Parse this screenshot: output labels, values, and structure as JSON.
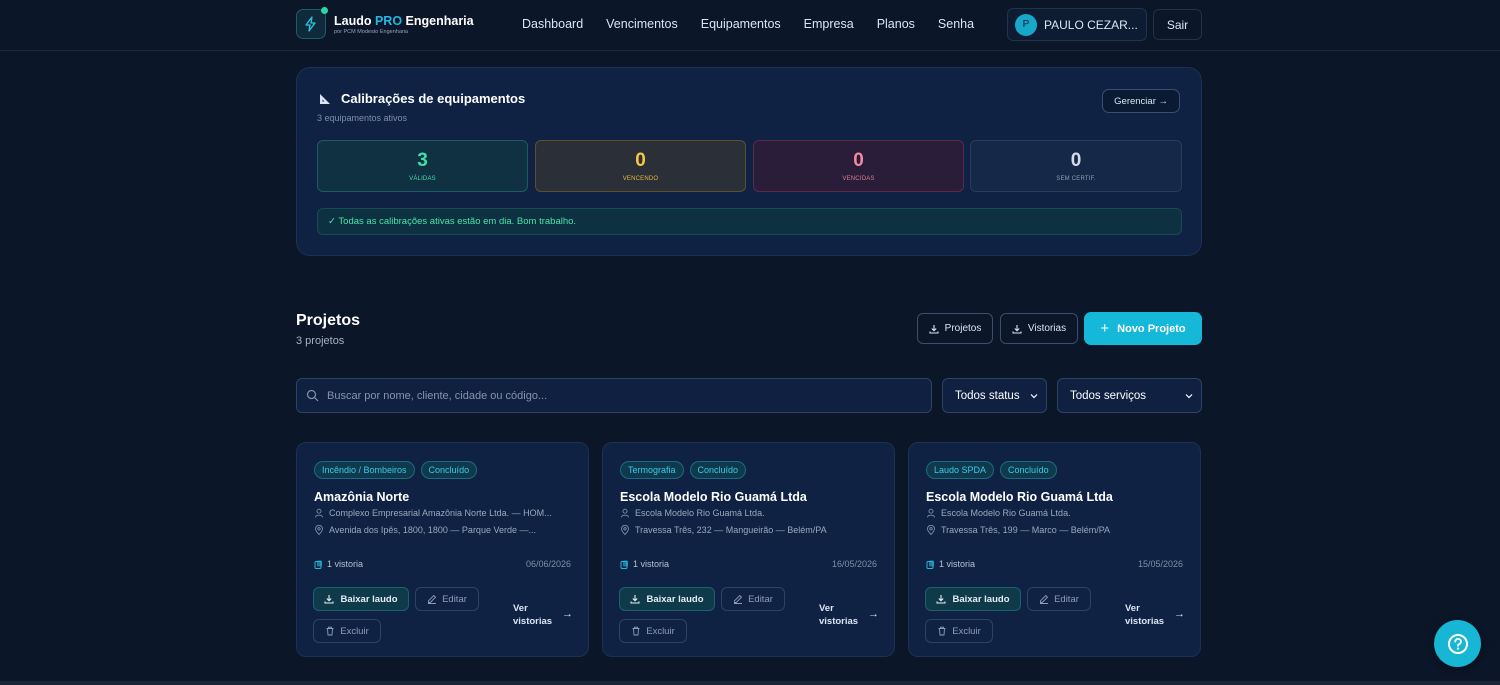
{
  "brand": {
    "title_main": "Laudo ",
    "title_pro": "PRO",
    "title_rest": " Engenharia",
    "subtitle": "por PCM Modesto Engenharia"
  },
  "nav": [
    "Dashboard",
    "Vencimentos",
    "Equipamentos",
    "Empresa",
    "Planos",
    "Senha"
  ],
  "user": {
    "initial": "P",
    "name": "PAULO CEZAR..."
  },
  "logout_label": "Sair",
  "calibration": {
    "title": "Calibrações de equipamentos",
    "subtitle": "3 equipamentos ativos",
    "manage_label": "Gerenciar →",
    "stats": {
      "valid": {
        "value": "3",
        "label": "VÁLIDAS"
      },
      "due": {
        "value": "0",
        "label": "VENCENDO"
      },
      "overdue": {
        "value": "0",
        "label": "VENCIDAS"
      },
      "no_cert": {
        "value": "0",
        "label": "SEM CERTIF."
      }
    },
    "ok_message": "✓ Todas as calibrações ativas estão em dia. Bom trabalho."
  },
  "projects": {
    "title": "Projetos",
    "count": "3 projetos",
    "export_projects_label": "Projetos",
    "export_inspections_label": "Vistorias",
    "new_project_label": "Novo Projeto",
    "search_placeholder": "Buscar por nome, cliente, cidade ou código...",
    "status_filter": "Todos status",
    "service_filter": "Todos serviços",
    "cards": [
      {
        "tags": [
          "Incêndio / Bombeiros",
          "Concluído"
        ],
        "title": "Amazônia Norte",
        "client": "Complexo Empresarial Amazônia Norte Ltda. — HOM...",
        "address": "Avenida dos Ipês, 1800, 1800 — Parque Verde —...",
        "inspections": "1 vistoria",
        "date": "06/06/2026"
      },
      {
        "tags": [
          "Termografia",
          "Concluído"
        ],
        "title": "Escola Modelo Rio Guamá Ltda",
        "client": "Escola Modelo Rio Guamá Ltda.",
        "address": "Travessa Três, 232 — Mangueirão — Belém/PA",
        "inspections": "1 vistoria",
        "date": "16/05/2026"
      },
      {
        "tags": [
          "Laudo SPDA",
          "Concluído"
        ],
        "title": "Escola Modelo Rio Guamá Ltda",
        "client": "Escola Modelo Rio Guamá Ltda.",
        "address": "Travessa Três, 199 — Marco — Belém/PA",
        "inspections": "1 vistoria",
        "date": "15/05/2026"
      }
    ],
    "card_actions": {
      "download": "Baixar laudo",
      "edit": "Editar",
      "delete": "Excluir",
      "see_line1": "Ver",
      "see_line2": "vistorias"
    }
  },
  "colors": {
    "background": "#0b1628",
    "card": "#0f2244",
    "accent": "#15b8d8",
    "valid": "#3ee0a8",
    "due": "#f5c842",
    "overdue": "#f08aa0"
  }
}
